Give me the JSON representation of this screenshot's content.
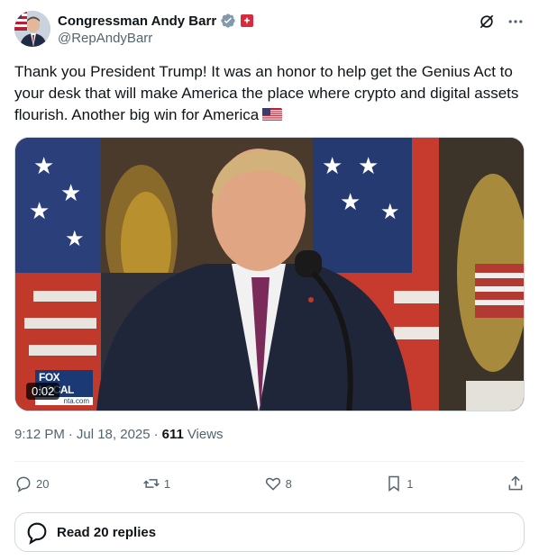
{
  "author": {
    "display_name": "Congressman Andy Barr",
    "handle": "@RepAndyBarr",
    "verified_color": "#829aab",
    "affiliation_color": "#d72a3c"
  },
  "top_icons": [
    "grok-icon",
    "more-icon"
  ],
  "tweet": {
    "text": "Thank you President Trump! It was an honor to help get the Genius Act to your desk that will make America the place where crypto and digital assets flourish. Another big win for America",
    "emoji": "🇺🇸"
  },
  "media": {
    "duration": "0:02",
    "logo_top": "FOX LOCAL",
    "logo_bottom": "nta.com"
  },
  "meta": {
    "time": "9:12 PM",
    "date": "Jul 18, 2025",
    "views_count": "611",
    "views_label": "Views",
    "separator": "·"
  },
  "actions": {
    "replies": "20",
    "reposts": "1",
    "likes": "8",
    "bookmarks": "1"
  },
  "read_replies": "Read 20 replies",
  "colors": {
    "text": "#0f1419",
    "secondary": "#536471",
    "border": "#cfd9de"
  }
}
